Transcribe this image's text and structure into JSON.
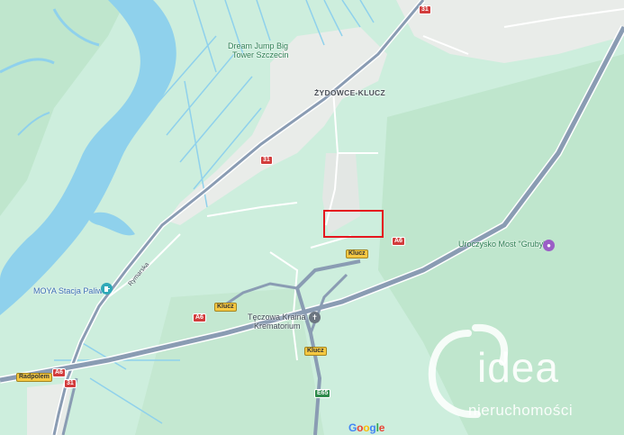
{
  "map": {
    "places": {
      "village": "ŻYDOWCE-KLUCZ",
      "dream_jump_line1": "Dream Jump Big",
      "dream_jump_line2": "Tower Szczecin",
      "uroczysko": "Uroczysko Most \"Gruby\"",
      "moya": "MOYA Stacja Paliw",
      "teczowa_line1": "Tęczowa Kraina",
      "teczowa_line2": "Krematorium",
      "rymarska": "Rymarska",
      "radpol": "Radpolem"
    },
    "shields": {
      "r31_top": "31",
      "r31_mid": "31",
      "r31_bottom": "31",
      "a6_east": "A6",
      "a6_mid": "A6",
      "a6_west": "A6",
      "klucz_east": "Klucz",
      "klucz_mid": "Klucz",
      "klucz_south": "Klucz",
      "e65": "E65",
      "radpol_sign": "Radpolem"
    },
    "google_logo": {
      "letters": [
        "G",
        "o",
        "o",
        "g",
        "l",
        "e"
      ],
      "colors": [
        "#4285F4",
        "#EA4335",
        "#FBBC05",
        "#4285F4",
        "#34A853",
        "#EA4335"
      ]
    },
    "watermark": {
      "brand": "idea",
      "subtitle": "nieruchomości"
    },
    "colors": {
      "land": "#cdeedd",
      "forest": "#b7e2c6",
      "water": "#8fd1ec",
      "motorway": "#8a9cb3",
      "road": "#ffffff",
      "urban": "#e9ece9",
      "selection": "#e5161f"
    }
  }
}
